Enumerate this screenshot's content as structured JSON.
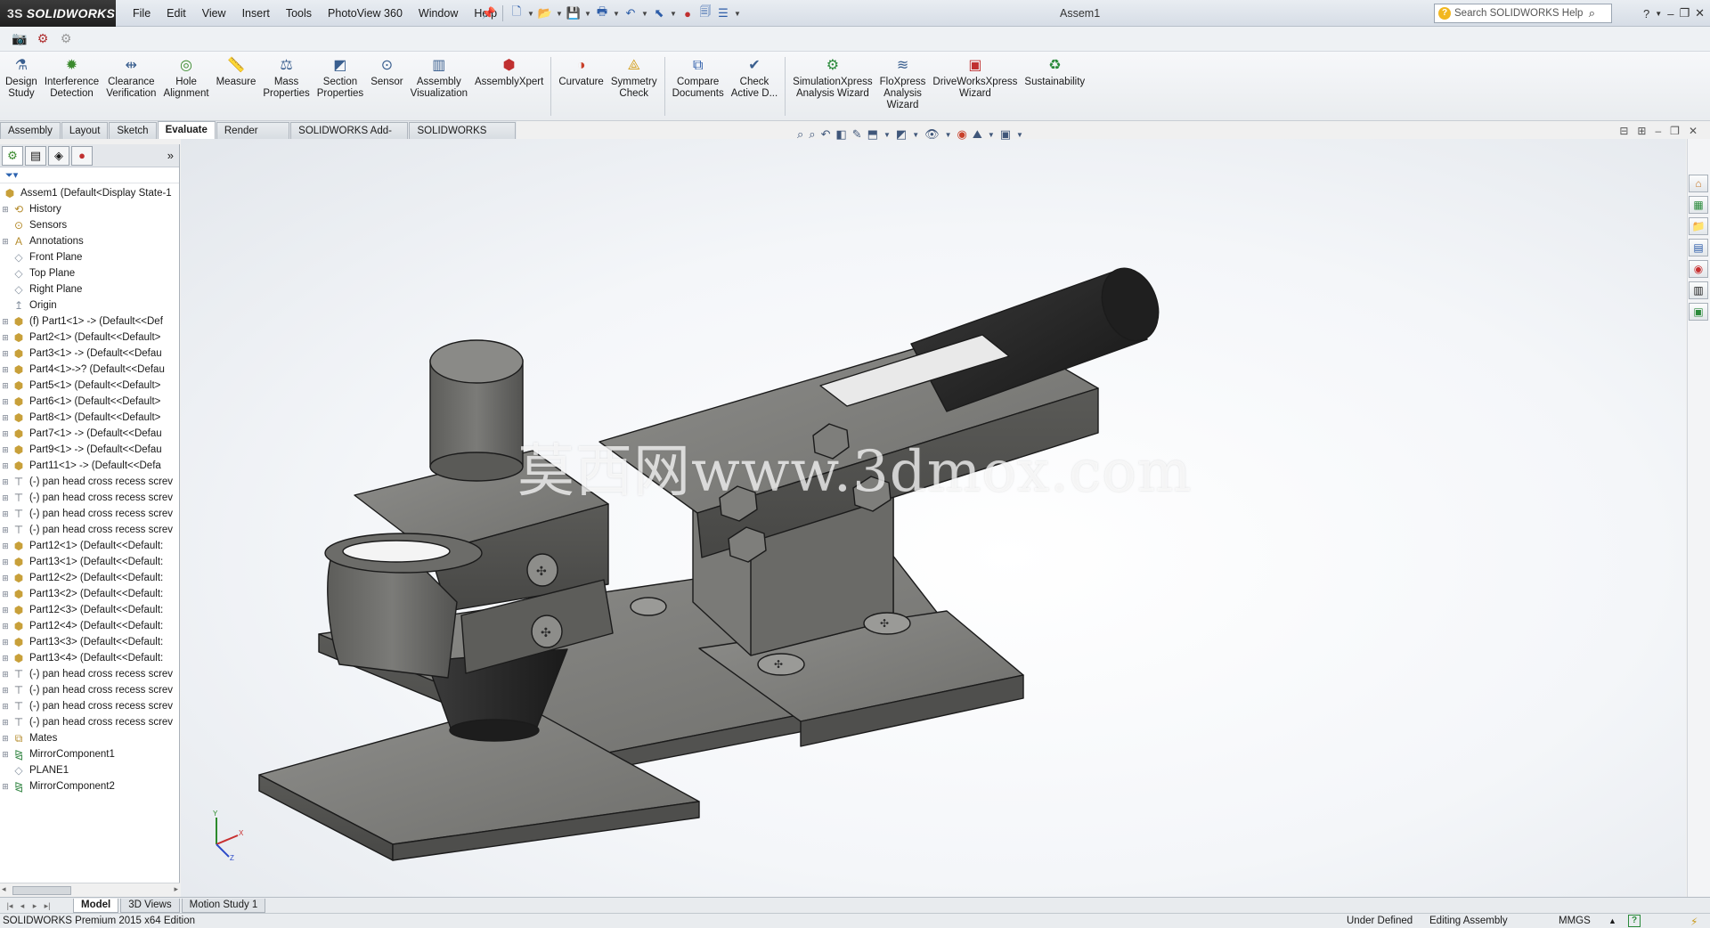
{
  "app": {
    "logo_ds": "3S",
    "logo_text": "SOLIDWORKS",
    "doc_title": "Assem1",
    "help_search_placeholder": "Search SOLIDWORKS Help"
  },
  "menu": [
    "File",
    "Edit",
    "View",
    "Insert",
    "Tools",
    "PhotoView 360",
    "Window",
    "Help"
  ],
  "commands": [
    {
      "label": "Design\nStudy",
      "icon": "design-study-icon"
    },
    {
      "label": "Interference\nDetection",
      "icon": "interference-detection-icon"
    },
    {
      "label": "Clearance\nVerification",
      "icon": "clearance-verification-icon"
    },
    {
      "label": "Hole\nAlignment",
      "icon": "hole-alignment-icon"
    },
    {
      "label": "Measure",
      "icon": "measure-icon"
    },
    {
      "label": "Mass\nProperties",
      "icon": "mass-properties-icon"
    },
    {
      "label": "Section\nProperties",
      "icon": "section-properties-icon"
    },
    {
      "label": "Sensor",
      "icon": "sensor-icon"
    },
    {
      "label": "Assembly\nVisualization",
      "icon": "assembly-visualization-icon"
    },
    {
      "label": "AssemblyXpert",
      "icon": "assemblyxpert-icon"
    },
    {
      "label": "Curvature",
      "icon": "curvature-icon"
    },
    {
      "label": "Symmetry\nCheck",
      "icon": "symmetry-check-icon"
    },
    {
      "label": "Compare\nDocuments",
      "icon": "compare-documents-icon"
    },
    {
      "label": "Check\nActive D...",
      "icon": "check-active-document-icon"
    },
    {
      "label": "SimulationXpress\nAnalysis Wizard",
      "icon": "simulationxpress-icon"
    },
    {
      "label": "FloXpress\nAnalysis\nWizard",
      "icon": "floxpress-icon"
    },
    {
      "label": "DriveWorksXpress\nWizard",
      "icon": "driveworksxpress-icon"
    },
    {
      "label": "Sustainability",
      "icon": "sustainability-icon"
    }
  ],
  "cm_tabs": [
    {
      "label": "Assembly",
      "active": false
    },
    {
      "label": "Layout",
      "active": false
    },
    {
      "label": "Sketch",
      "active": false
    },
    {
      "label": "Evaluate",
      "active": true
    },
    {
      "label": "Render Tools",
      "active": false
    },
    {
      "label": "SOLIDWORKS Add-Ins",
      "active": false
    },
    {
      "label": "SOLIDWORKS MBD",
      "active": false
    }
  ],
  "tree": {
    "root": "Assem1  (Default<Display State-1",
    "items": [
      {
        "label": "History",
        "icon": "history",
        "exp": true
      },
      {
        "label": "Sensors",
        "icon": "sensor",
        "exp": false
      },
      {
        "label": "Annotations",
        "icon": "annotation",
        "exp": true
      },
      {
        "label": "Front Plane",
        "icon": "plane",
        "exp": false
      },
      {
        "label": "Top Plane",
        "icon": "plane",
        "exp": false
      },
      {
        "label": "Right Plane",
        "icon": "plane",
        "exp": false
      },
      {
        "label": "Origin",
        "icon": "origin",
        "exp": false
      },
      {
        "label": "(f) Part1<1> -> (Default<<Def",
        "icon": "part",
        "exp": true
      },
      {
        "label": "Part2<1> (Default<<Default>",
        "icon": "part",
        "exp": true
      },
      {
        "label": "Part3<1> -> (Default<<Defau",
        "icon": "part",
        "exp": true
      },
      {
        "label": "Part4<1>->? (Default<<Defau",
        "icon": "part",
        "exp": true
      },
      {
        "label": "Part5<1> (Default<<Default>",
        "icon": "part",
        "exp": true
      },
      {
        "label": "Part6<1> (Default<<Default>",
        "icon": "part",
        "exp": true
      },
      {
        "label": "Part8<1> (Default<<Default>",
        "icon": "part",
        "exp": true
      },
      {
        "label": "Part7<1> -> (Default<<Defau",
        "icon": "part",
        "exp": true
      },
      {
        "label": "Part9<1> -> (Default<<Defau",
        "icon": "part",
        "exp": true
      },
      {
        "label": "Part11<1> -> (Default<<Defa",
        "icon": "part",
        "exp": true
      },
      {
        "label": "(-) pan head cross recess screv",
        "icon": "screw",
        "exp": true
      },
      {
        "label": "(-) pan head cross recess screv",
        "icon": "screw",
        "exp": true
      },
      {
        "label": "(-) pan head cross recess screv",
        "icon": "screw",
        "exp": true
      },
      {
        "label": "(-) pan head cross recess screv",
        "icon": "screw",
        "exp": true
      },
      {
        "label": "Part12<1> (Default<<Default:",
        "icon": "part",
        "exp": true
      },
      {
        "label": "Part13<1> (Default<<Default:",
        "icon": "part",
        "exp": true
      },
      {
        "label": "Part12<2> (Default<<Default:",
        "icon": "part",
        "exp": true
      },
      {
        "label": "Part13<2> (Default<<Default:",
        "icon": "part",
        "exp": true
      },
      {
        "label": "Part12<3> (Default<<Default:",
        "icon": "part",
        "exp": true
      },
      {
        "label": "Part12<4> (Default<<Default:",
        "icon": "part",
        "exp": true
      },
      {
        "label": "Part13<3> (Default<<Default:",
        "icon": "part",
        "exp": true
      },
      {
        "label": "Part13<4> (Default<<Default:",
        "icon": "part",
        "exp": true
      },
      {
        "label": "(-) pan head cross recess screv",
        "icon": "screw",
        "exp": true
      },
      {
        "label": "(-) pan head cross recess screv",
        "icon": "screw",
        "exp": true
      },
      {
        "label": "(-) pan head cross recess screv",
        "icon": "screw",
        "exp": true
      },
      {
        "label": "(-) pan head cross recess screv",
        "icon": "screw",
        "exp": true
      },
      {
        "label": "Mates",
        "icon": "mates",
        "exp": true
      },
      {
        "label": "MirrorComponent1",
        "icon": "mirror",
        "exp": true
      },
      {
        "label": "PLANE1",
        "icon": "plane",
        "exp": false
      },
      {
        "label": "MirrorComponent2",
        "icon": "mirror",
        "exp": true
      }
    ]
  },
  "watermark": "莫西网www.3dmox.com",
  "bottom_tabs": [
    {
      "label": "Model",
      "active": true
    },
    {
      "label": "3D Views",
      "active": false
    },
    {
      "label": "Motion Study 1",
      "active": false
    }
  ],
  "status": {
    "edition": "SOLIDWORKS Premium 2015 x64 Edition",
    "definition": "Under Defined",
    "mode": "Editing Assembly",
    "units": "MMGS",
    "help_glyph": "?"
  }
}
